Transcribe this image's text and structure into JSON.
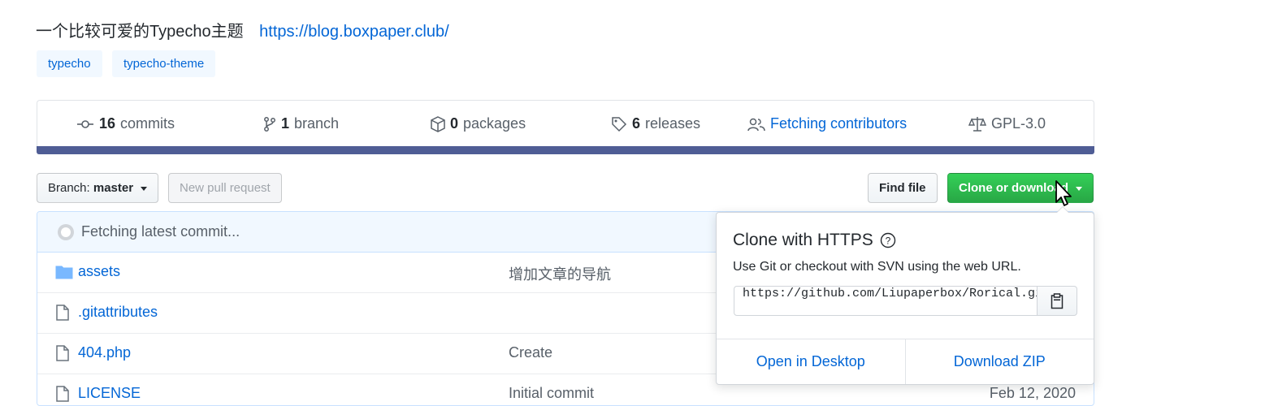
{
  "repo": {
    "description": "一个比较可爱的Typecho主题",
    "homepage": "https://blog.boxpaper.club/",
    "topics": [
      "typecho",
      "typecho-theme"
    ]
  },
  "summary": {
    "commits_count": "16",
    "commits_label": "commits",
    "branches_count": "1",
    "branches_label": "branch",
    "packages_count": "0",
    "packages_label": "packages",
    "releases_count": "6",
    "releases_label": "releases",
    "contributors_label": "Fetching contributors",
    "license": "GPL-3.0",
    "language_color": "#4f5d95"
  },
  "toolbar": {
    "branch_prefix": "Branch:",
    "branch_name": "master",
    "new_pr_label": "New pull request",
    "find_file_label": "Find file",
    "clone_label": "Clone or download"
  },
  "filelist": {
    "commit_status": "Fetching latest commit...",
    "rows": [
      {
        "name": "assets",
        "message": "增加文章的导航",
        "type": "folder",
        "age": ""
      },
      {
        "name": ".gitattributes",
        "message": "",
        "type": "file",
        "age": ""
      },
      {
        "name": "404.php",
        "message": "Create",
        "type": "file",
        "age": ""
      },
      {
        "name": "LICENSE",
        "message": "Initial commit",
        "type": "file",
        "age": "Feb 12, 2020"
      }
    ]
  },
  "clone_popover": {
    "title": "Clone with HTTPS",
    "subtitle": "Use Git or checkout with SVN using the web URL.",
    "url": "https://github.com/Liupaperbox/Rorical.git",
    "open_desktop_label": "Open in Desktop",
    "download_zip_label": "Download ZIP"
  }
}
